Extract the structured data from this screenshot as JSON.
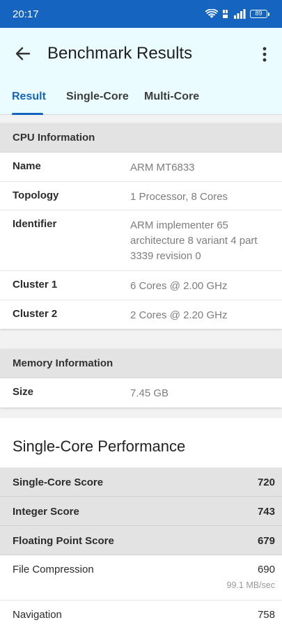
{
  "status_bar": {
    "time": "20:17",
    "battery": "89"
  },
  "app_bar": {
    "title": "Benchmark Results"
  },
  "tabs": [
    {
      "label": "Result",
      "active": true
    },
    {
      "label": "Single-Core",
      "active": false
    },
    {
      "label": "Multi-Core",
      "active": false
    }
  ],
  "cpu_info": {
    "header": "CPU Information",
    "rows": [
      {
        "label": "Name",
        "value": "ARM MT6833"
      },
      {
        "label": "Topology",
        "value": "1 Processor, 8 Cores"
      },
      {
        "label": "Identifier",
        "value": "ARM implementer 65 architecture 8 variant 4 part 3339 revision 0"
      },
      {
        "label": "Cluster 1",
        "value": "6 Cores @ 2.00 GHz"
      },
      {
        "label": "Cluster 2",
        "value": "2 Cores @ 2.20 GHz"
      }
    ]
  },
  "memory_info": {
    "header": "Memory Information",
    "rows": [
      {
        "label": "Size",
        "value": "7.45 GB"
      }
    ]
  },
  "single_core": {
    "title": "Single-Core Performance",
    "scores": [
      {
        "label": "Single-Core Score",
        "value": "720"
      },
      {
        "label": "Integer Score",
        "value": "743"
      },
      {
        "label": "Floating Point Score",
        "value": "679"
      }
    ],
    "benchmarks": [
      {
        "label": "File Compression",
        "value": "690",
        "detail": "99.1 MB/sec"
      },
      {
        "label": "Navigation",
        "value": "758"
      }
    ]
  },
  "colors": {
    "status_bar": "#1565c0",
    "accent": "#1565c0",
    "app_bar": "#eafcff"
  }
}
